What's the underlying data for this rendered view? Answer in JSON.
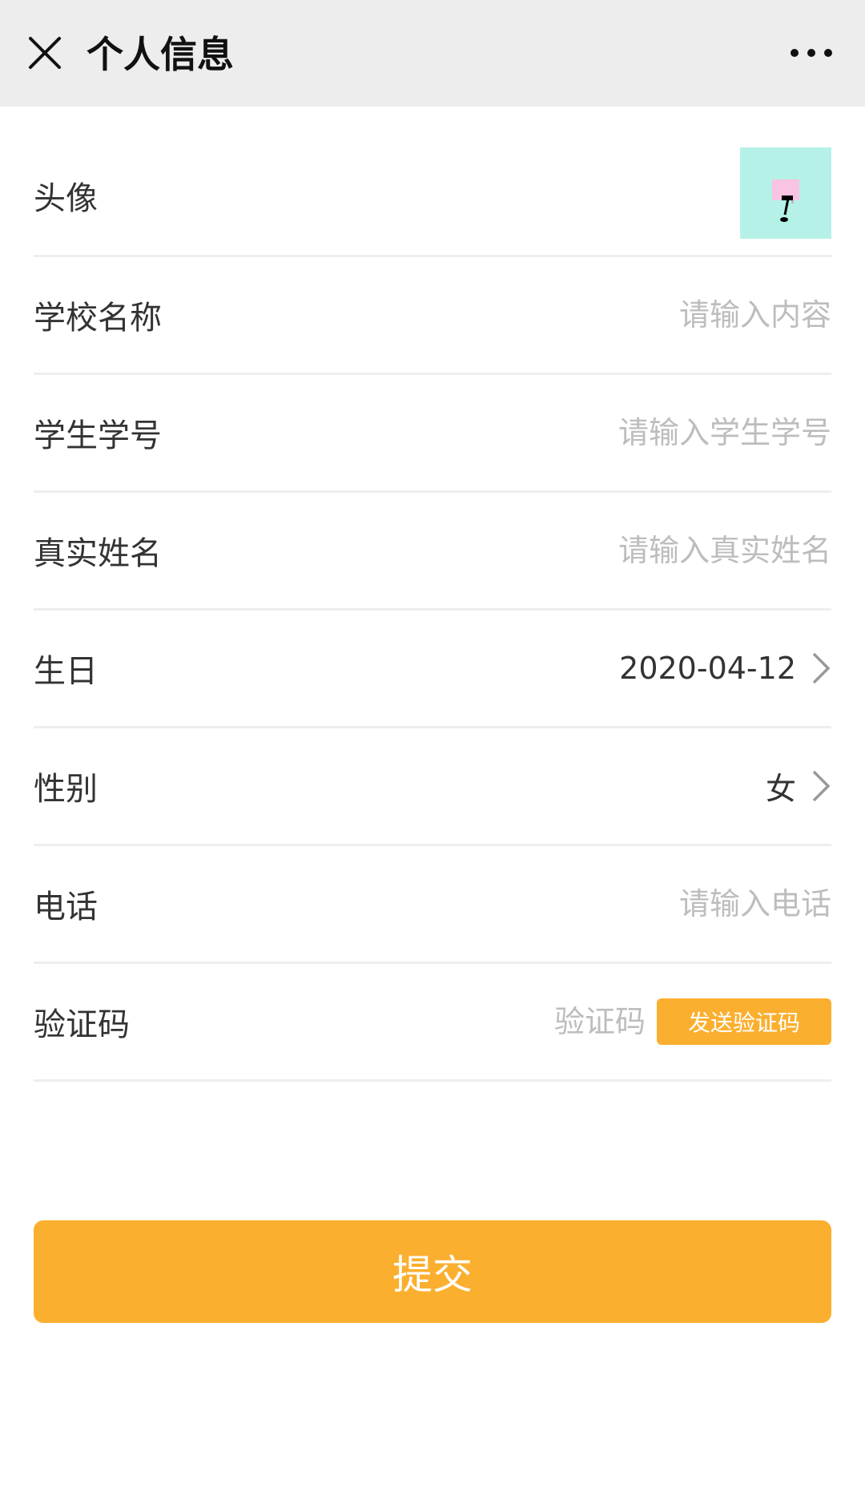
{
  "navbar": {
    "title": "个人信息",
    "close_icon": "close-icon",
    "more_icon": "more-horizontal-icon"
  },
  "form": {
    "avatar_label": "头像",
    "school": {
      "label": "学校名称",
      "placeholder": "请输入内容",
      "value": ""
    },
    "student_id": {
      "label": "学生学号",
      "placeholder": "请输入学生学号",
      "value": ""
    },
    "real_name": {
      "label": "真实姓名",
      "placeholder": "请输入真实姓名",
      "value": ""
    },
    "birthday": {
      "label": "生日",
      "value": "2020-04-12"
    },
    "gender": {
      "label": "性别",
      "value": "女"
    },
    "phone": {
      "label": "电话",
      "placeholder": "请输入电话",
      "value": ""
    },
    "code": {
      "label": "验证码",
      "placeholder": "验证码",
      "value": "",
      "send_label": "发送验证码"
    }
  },
  "submit_label": "提交",
  "colors": {
    "accent": "#fbaf2f",
    "navbar_bg": "#ededed",
    "placeholder": "#bdbdbd",
    "avatar_bg": "#b6f1e8"
  }
}
